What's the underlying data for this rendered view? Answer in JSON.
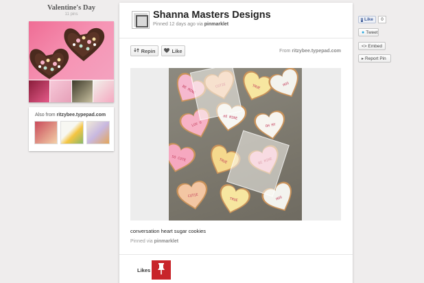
{
  "board": {
    "title": "Valentine's Day",
    "pin_count": "11 pins"
  },
  "also_from": {
    "prefix": "Also from ",
    "domain": "ritzybee.typepad.com"
  },
  "pin": {
    "pinner_name": "Shanna Masters Designs",
    "pinned_prefix": "Pinned 12 days ago via ",
    "pinned_via_user": "pinmarklet",
    "repin_label": "Repin",
    "like_label": "Like",
    "from_prefix": "From ",
    "from_domain": "ritzybee.typepad.com",
    "description": "conversation heart sugar cookies",
    "footer_prefix": "Pinned via ",
    "footer_user": "pinmarklet",
    "likes_label": "Likes"
  },
  "cookies": [
    {
      "text": "BE MINE",
      "color": "#f6b9cf"
    },
    {
      "text": "CUTIE",
      "color": "#f3c6a3"
    },
    {
      "text": "TRUE",
      "color": "#f7e6a0"
    },
    {
      "text": "HUG",
      "color": "#f3f3ee"
    },
    {
      "text": "LUV U",
      "color": "#f7b2c6"
    },
    {
      "text": "BE MINE",
      "color": "#f7f7f4"
    },
    {
      "text": "OH MY",
      "color": "#f7f5f0"
    },
    {
      "text": "SO CUTE",
      "color": "#f6a8c0"
    },
    {
      "text": "TRUE",
      "color": "#f5d98d"
    }
  ],
  "social": {
    "fb_like_label": "Like",
    "fb_count": "0",
    "tweet_label": "Tweet",
    "embed_label": "<> Embed",
    "report_label": "Report Pin"
  },
  "colors": {
    "page_bg": "#efeded",
    "likes_badge": "#c8242a",
    "facebook_blue": "#3b5998"
  }
}
